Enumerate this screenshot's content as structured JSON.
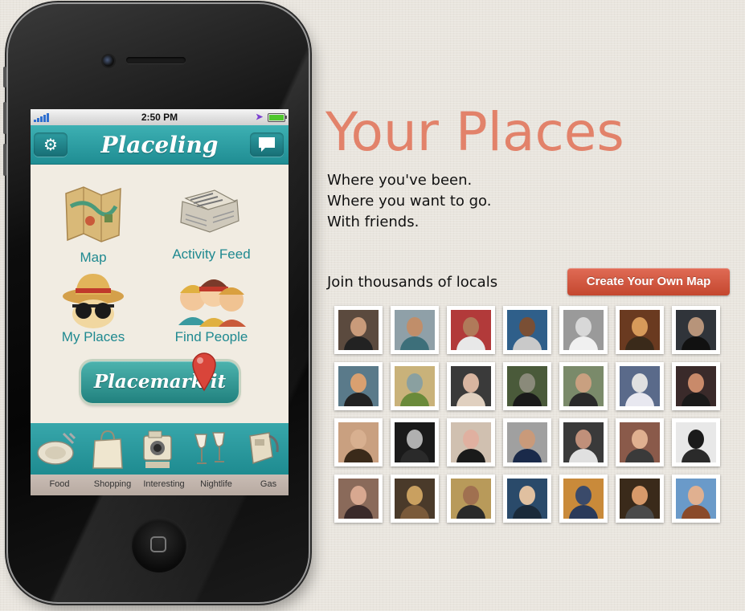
{
  "phone": {
    "status_bar": {
      "time": "2:50 PM"
    },
    "nav": {
      "title": "Placeling",
      "settings_icon": "gear-icon",
      "chat_icon": "speech-bubble-icon"
    },
    "tiles": [
      {
        "label": "Map",
        "icon": "folded-map-icon"
      },
      {
        "label": "Activity Feed",
        "icon": "newspaper-icon"
      },
      {
        "label": "My Places",
        "icon": "hat-sunglasses-icon"
      },
      {
        "label": "Find People",
        "icon": "people-group-icon"
      }
    ],
    "placemark_button": {
      "label": "Placemark it",
      "icon": "map-pin-icon"
    },
    "categories": [
      {
        "label": "Food",
        "icon": "plate-cutlery-icon"
      },
      {
        "label": "Shopping",
        "icon": "shopping-bag-icon"
      },
      {
        "label": "Interesting",
        "icon": "camera-icon"
      },
      {
        "label": "Nightlife",
        "icon": "wine-glasses-icon"
      },
      {
        "label": "Gas",
        "icon": "gas-pump-icon"
      }
    ]
  },
  "hero": {
    "title": "Your Places",
    "taglines": [
      "Where you've been.",
      "Where you want to go.",
      "With friends."
    ],
    "join_text": "Join thousands of locals",
    "cta_label": "Create Your Own Map"
  },
  "avatars": [
    [
      {
        "bg": "#5b4a3e",
        "face": "#c99b7a",
        "body": "#222"
      },
      {
        "bg": "#8fa0a8",
        "face": "#c08e6a",
        "body": "#3d6f7a"
      },
      {
        "bg": "#b23a3a",
        "face": "#b07a5a",
        "body": "#e8e8e8"
      },
      {
        "bg": "#2f5f8a",
        "face": "#7a4f35",
        "body": "#c9c9c9"
      },
      {
        "bg": "#9a9a9a",
        "face": "#d8d8d8",
        "body": "#f0f0f0"
      },
      {
        "bg": "#6a3a20",
        "face": "#d79a5a",
        "body": "#3a2a1a"
      },
      {
        "bg": "#30343a",
        "face": "#b7947a",
        "body": "#111"
      }
    ],
    [
      {
        "bg": "#5a7a8a",
        "face": "#d9a070",
        "body": "#222"
      },
      {
        "bg": "#c9b27a",
        "face": "#8aa0a0",
        "body": "#6a8a3a"
      },
      {
        "bg": "#3a3a3a",
        "face": "#d8b5a0",
        "body": "#e0d0c0"
      },
      {
        "bg": "#4a5a3a",
        "face": "#8a8a7a",
        "body": "#1a1a1a"
      },
      {
        "bg": "#7a8a6a",
        "face": "#c9a080",
        "body": "#2a2a2a"
      },
      {
        "bg": "#5a6a8a",
        "face": "#e0e0e0",
        "body": "#e8e8f0"
      },
      {
        "bg": "#3a2a2a",
        "face": "#c98a6a",
        "body": "#1a1a1a"
      }
    ],
    [
      {
        "bg": "#c9a080",
        "face": "#d8b090",
        "body": "#3a2a1a"
      },
      {
        "bg": "#1a1a1a",
        "face": "#b0b0b0",
        "body": "#2a2a2a"
      },
      {
        "bg": "#d0c0b0",
        "face": "#e0b0a0",
        "body": "#1a1a1a"
      },
      {
        "bg": "#a0a0a0",
        "face": "#c99a7a",
        "body": "#1a2a4a"
      },
      {
        "bg": "#3a3a3a",
        "face": "#c0907a",
        "body": "#e0e0e0"
      },
      {
        "bg": "#8a5a4a",
        "face": "#e0b090",
        "body": "#3a3a3a"
      },
      {
        "bg": "#e8e8e8",
        "face": "#1a1a1a",
        "body": "#2a2a2a"
      }
    ],
    [
      {
        "bg": "#8a6a5a",
        "face": "#d8a890",
        "body": "#3a2a2a"
      },
      {
        "bg": "#4a3a2a",
        "face": "#c9a060",
        "body": "#7a5a3a"
      },
      {
        "bg": "#b89a5a",
        "face": "#a07050",
        "body": "#2a2a2a"
      },
      {
        "bg": "#2a4a6a",
        "face": "#e0c0a0",
        "body": "#1a2a3a"
      },
      {
        "bg": "#c98a3a",
        "face": "#3a4a6a",
        "body": "#2a3a5a"
      },
      {
        "bg": "#3a2a1a",
        "face": "#d89a6a",
        "body": "#4a4a4a"
      },
      {
        "bg": "#6a9ac9",
        "face": "#e0b090",
        "body": "#8a4a2a"
      }
    ]
  ]
}
